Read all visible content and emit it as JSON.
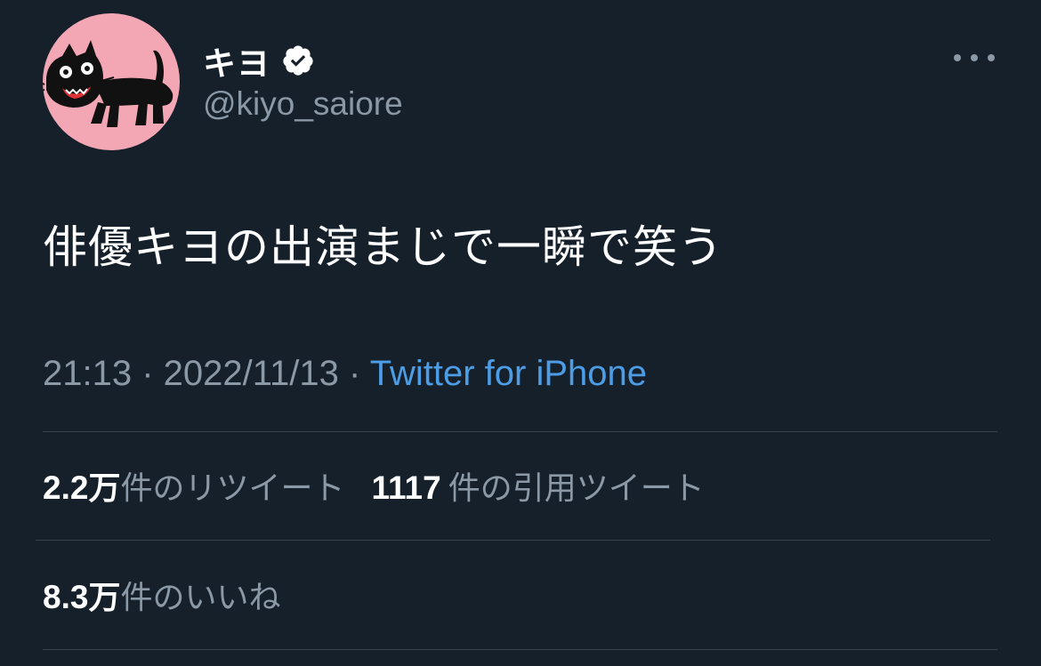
{
  "tweet": {
    "author": {
      "display_name": "キヨ",
      "username": "@kiyo_saiore",
      "verified": true
    },
    "text": "俳優キヨの出演まじで一瞬で笑う",
    "time": "21:13",
    "separator": "·",
    "date": "2022/11/13",
    "source": "Twitter for iPhone",
    "stats": {
      "retweets": {
        "value": "2.2",
        "unit": "万",
        "label": "件のリツイート"
      },
      "quotes": {
        "value": "1117",
        "unit": "",
        "label": "件の引用ツイート"
      },
      "likes": {
        "value": "8.3",
        "unit": "万",
        "label": "件のいいね"
      }
    }
  },
  "icons": {
    "more": "more-horizontal-icon",
    "verified": "verified-badge-icon"
  },
  "colors": {
    "background": "#15202b",
    "text_primary": "#ffffff",
    "text_secondary": "#8b98a5",
    "link": "#4d9de6",
    "divider": "#38444d",
    "avatar_background": "#f3a7b4"
  }
}
